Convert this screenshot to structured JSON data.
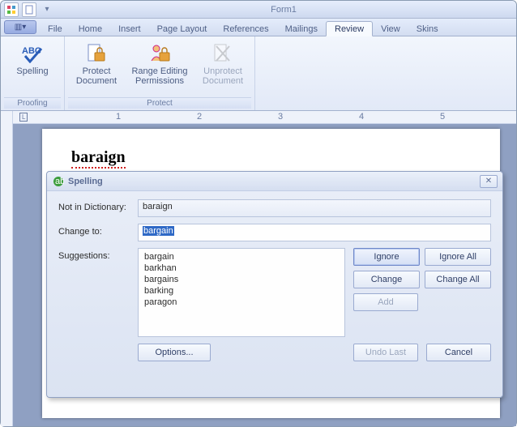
{
  "window": {
    "title": "Form1"
  },
  "tabs": [
    "File",
    "Home",
    "Insert",
    "Page Layout",
    "References",
    "Mailings",
    "Review",
    "View",
    "Skins"
  ],
  "active_tab": "Review",
  "ribbon": {
    "groups": [
      {
        "label": "Proofing",
        "items": [
          {
            "label": "Spelling"
          }
        ]
      },
      {
        "label": "Protect",
        "items": [
          {
            "label": "Protect Document"
          },
          {
            "label": "Range Editing Permissions"
          },
          {
            "label": "Unprotect Document",
            "disabled": true
          }
        ]
      }
    ]
  },
  "document": {
    "word": "baraign"
  },
  "ruler_numbers": [
    "1",
    "2",
    "3",
    "4",
    "5"
  ],
  "dialog": {
    "title": "Spelling",
    "labels": {
      "not_in_dict": "Not in Dictionary:",
      "change_to": "Change to:",
      "suggestions": "Suggestions:"
    },
    "not_in_dict_value": "baraign",
    "change_to_value": "bargain",
    "suggestions": [
      "bargain",
      "barkhan",
      "bargains",
      "barking",
      "paragon"
    ],
    "buttons": {
      "ignore": "Ignore",
      "ignore_all": "Ignore All",
      "change": "Change",
      "change_all": "Change All",
      "add": "Add",
      "options": "Options...",
      "undo_last": "Undo Last",
      "cancel": "Cancel"
    }
  }
}
